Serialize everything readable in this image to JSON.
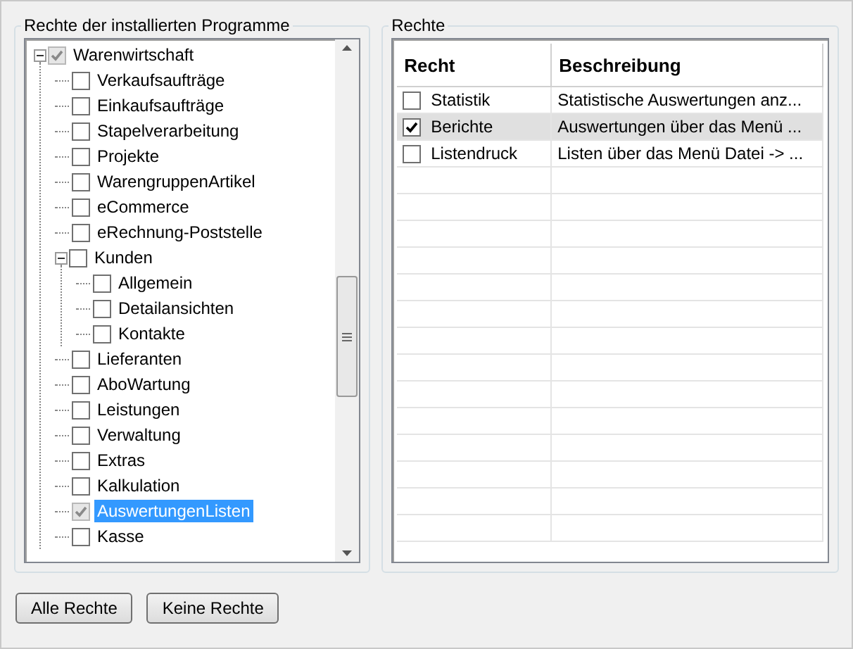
{
  "programs_panel": {
    "title": "Rechte der installierten Programme",
    "tree": [
      {
        "label": "Warenwirtschaft",
        "checked": true,
        "selected": false,
        "expanded": true,
        "children": [
          {
            "label": "Verkaufsaufträge",
            "checked": false,
            "selected": false
          },
          {
            "label": "Einkaufsaufträge",
            "checked": false,
            "selected": false
          },
          {
            "label": "Stapelverarbeitung",
            "checked": false,
            "selected": false
          },
          {
            "label": "Projekte",
            "checked": false,
            "selected": false
          },
          {
            "label": "WarengruppenArtikel",
            "checked": false,
            "selected": false
          },
          {
            "label": "eCommerce",
            "checked": false,
            "selected": false
          },
          {
            "label": "eRechnung-Poststelle",
            "checked": false,
            "selected": false
          },
          {
            "label": "Kunden",
            "checked": false,
            "selected": false,
            "expanded": true,
            "children": [
              {
                "label": "Allgemein",
                "checked": false,
                "selected": false
              },
              {
                "label": "Detailansichten",
                "checked": false,
                "selected": false
              },
              {
                "label": "Kontakte",
                "checked": false,
                "selected": false
              }
            ]
          },
          {
            "label": "Lieferanten",
            "checked": false,
            "selected": false
          },
          {
            "label": "AboWartung",
            "checked": false,
            "selected": false
          },
          {
            "label": "Leistungen",
            "checked": false,
            "selected": false
          },
          {
            "label": "Verwaltung",
            "checked": false,
            "selected": false
          },
          {
            "label": "Extras",
            "checked": false,
            "selected": false
          },
          {
            "label": "Kalkulation",
            "checked": false,
            "selected": false
          },
          {
            "label": "AuswertungenListen",
            "checked": true,
            "selected": true
          },
          {
            "label": "Kasse",
            "checked": false,
            "selected": false
          }
        ]
      }
    ]
  },
  "rights_panel": {
    "title": "Rechte",
    "table": {
      "columns": [
        "Recht",
        "Beschreibung"
      ],
      "rows": [
        {
          "name": "Statistik",
          "description": "Statistische Auswertungen anz...",
          "checked": false,
          "selected": false
        },
        {
          "name": "Berichte",
          "description": "Auswertungen über das Menü ...",
          "checked": true,
          "selected": true
        },
        {
          "name": "Listendruck",
          "description": "Listen über das Menü Datei -> ...",
          "checked": false,
          "selected": false
        }
      ]
    }
  },
  "buttons": [
    "Alle Rechte",
    "Keine Rechte"
  ]
}
